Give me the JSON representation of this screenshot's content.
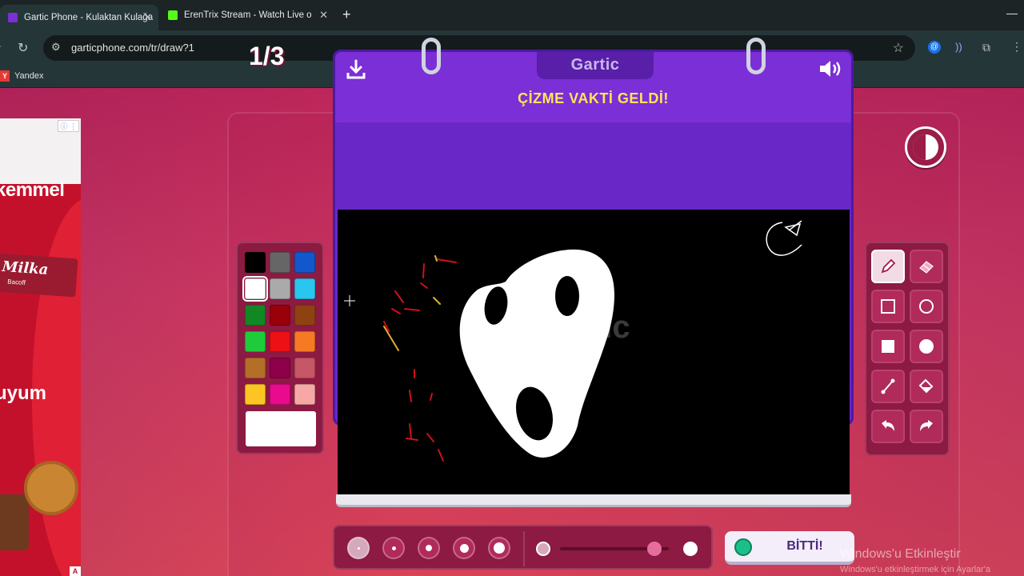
{
  "browser": {
    "tabs": [
      {
        "title": "Gartic Phone - Kulaktan Kulağa",
        "active": true,
        "favicon_color": "#7b2fd6"
      },
      {
        "title": "ErenTrix Stream - Watch Live on",
        "active": false,
        "favicon_color": "#53fc18"
      }
    ],
    "url": "garticphone.com/tr/draw?1",
    "bookmark": "Yandex",
    "bookmark_icon": "Y"
  },
  "ad": {
    "headline1": "kemmel",
    "brand": "Milka",
    "flavor": "Bacoff",
    "headline2": "uyum",
    "badge": "A"
  },
  "game": {
    "round": "1/3",
    "logo": "Gartic",
    "title": "ÇİZME VAKTİ GELDİ!",
    "done_label": "BİTTİ!",
    "palette": [
      "#000000",
      "#666666",
      "#1357cc",
      "#ffffff",
      "#aaaaaa",
      "#29c7ef",
      "#128824",
      "#99000a",
      "#8f4211",
      "#1ecc3b",
      "#ed1014",
      "#f67a24",
      "#b36f28",
      "#8e0049",
      "#c75666",
      "#fdc521",
      "#ea0a8e",
      "#f6a8a7"
    ],
    "selected_color": "#ffffff",
    "tools": [
      "pencil-icon",
      "eraser-icon",
      "rectangle-outline-icon",
      "circle-outline-icon",
      "rectangle-fill-icon",
      "circle-fill-icon",
      "line-icon",
      "bucket-icon",
      "undo-icon",
      "redo-icon"
    ],
    "active_tool": "pencil-icon",
    "brush_size_selected": 1,
    "opacity": 0.87
  },
  "os": {
    "activation_title": "Windows'u Etkinleştir",
    "activation_sub": "Windows'u etkinleştirmek için Ayarlar'a"
  }
}
